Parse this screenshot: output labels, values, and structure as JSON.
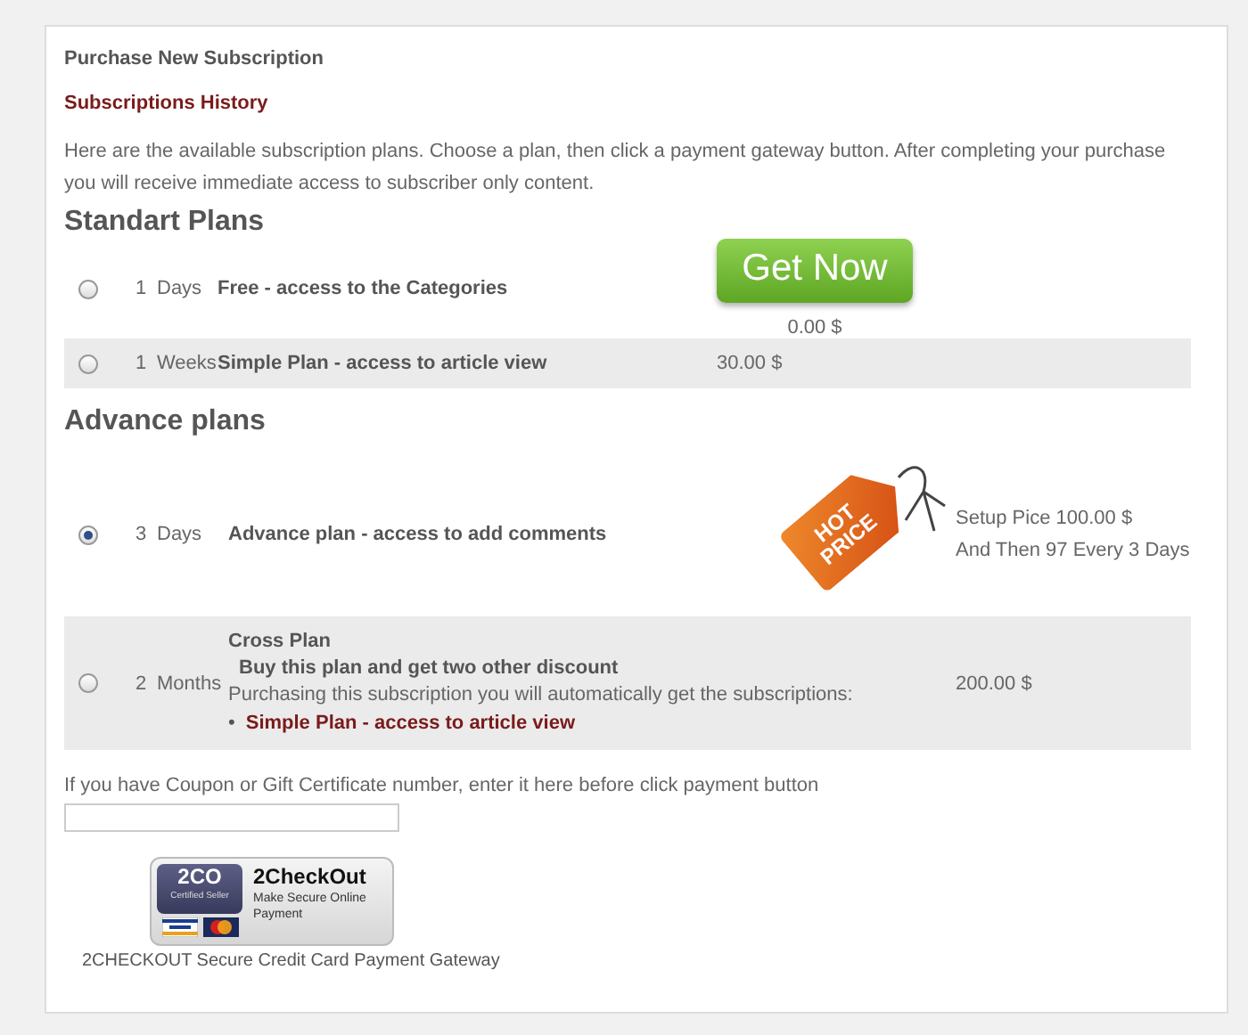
{
  "page": {
    "title": "Purchase New Subscription",
    "history_link": "Subscriptions History",
    "intro": "Here are the available subscription plans. Choose a plan, then click a payment gateway button. After completing your purchase you will receive immediate access to subscriber only content."
  },
  "sections": [
    {
      "heading": "Standart Plans",
      "plans": [
        {
          "selected": false,
          "count": "1",
          "unit": "Days",
          "name": "Free - access to the Categories",
          "extra": {
            "kind": "button",
            "label": "Get Now"
          },
          "price": [
            "0.00 $"
          ]
        },
        {
          "selected": false,
          "count": "1",
          "unit": "Weeks",
          "name": "Simple Plan - access to article view",
          "price": [
            "30.00 $"
          ]
        }
      ]
    },
    {
      "heading": "Advance plans",
      "plans": [
        {
          "selected": true,
          "count": "3",
          "unit": "Days",
          "name": "Advance plan - access to add comments",
          "extra": {
            "kind": "tag",
            "label": "HOT PRICE"
          },
          "price": [
            "Setup Pice 100.00 $",
            "And Then 97 Every 3 Days"
          ]
        },
        {
          "selected": false,
          "count": "2",
          "unit": "Months",
          "name": "Cross Plan",
          "subtitle": "Buy this plan and get two other discount",
          "note": "Purchasing this subscription you will automatically get the subscriptions:",
          "included": [
            {
              "bullet": "•",
              "label": "Simple Plan - access to article view"
            }
          ],
          "price": [
            "200.00 $"
          ]
        }
      ]
    }
  ],
  "coupon": {
    "label": "If you have Coupon or Gift Certificate number, enter it here before click payment button"
  },
  "gateway": {
    "seal": "2CO",
    "seal_caption": "Certified Seller",
    "brand": "2CheckOut",
    "tagline": "Make Secure Online Payment",
    "caption": "2CHECKOUT Secure Credit Card Payment Gateway"
  }
}
